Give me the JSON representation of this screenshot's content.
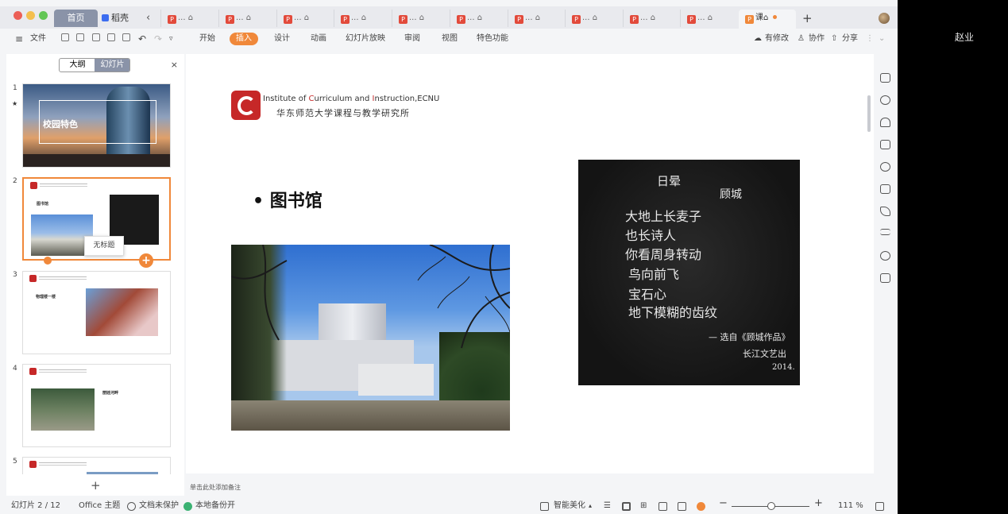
{
  "right_panel": {
    "username": "赵业"
  },
  "tabbar": {
    "home_label": "首页",
    "daoke_label": "稻壳",
    "nav_back": "‹",
    "doc_tab_label": "...",
    "active_tab_label": "课",
    "new_tab": "+"
  },
  "menubar": {
    "file_label": "文件",
    "menus": [
      "开始",
      "插入",
      "设计",
      "动画",
      "幻灯片放映",
      "审阅",
      "视图",
      "特色功能"
    ],
    "active_menu": "插入",
    "has_changes": "有修改",
    "collaborate": "协作",
    "share": "分享"
  },
  "leftpanel": {
    "outline_tab": "大纲",
    "slides_tab": "幻灯片",
    "close": "×",
    "slides": [
      {
        "num": "1",
        "title": "校园特色"
      },
      {
        "num": "2",
        "title": "图书馆"
      },
      {
        "num": "3",
        "title": "物理楼一楼"
      },
      {
        "num": "4",
        "title": "丽娃河畔"
      },
      {
        "num": "5",
        "title": ""
      }
    ],
    "tooltip": "无标题",
    "add_slide": "+"
  },
  "slide": {
    "institute_en_prefix": "Institute of ",
    "institute_en_c1": "C",
    "institute_en_mid": "urriculum and ",
    "institute_en_i": "I",
    "institute_en_suffix": "nstruction,ECNU",
    "institute_cn": "华东师范大学课程与教学研究所",
    "bullet": "• 图书馆",
    "poem": {
      "title": "日晕",
      "author": "顾城",
      "lines": [
        "大地上长麦子",
        "也长诗人",
        "你看周身转动",
        "鸟向前飞",
        "宝石心",
        "地下模糊的齿纹"
      ],
      "source_1": "— 选自《顾城作品》",
      "source_2": "长江文艺出",
      "source_3": "2014."
    }
  },
  "notes_hint": "单击此处添加备注",
  "statusbar": {
    "slide_counter": "幻灯片 2 / 12",
    "theme": "Office 主题",
    "protect": "文档未保护",
    "backup": "本地备份开",
    "beautify": "智能美化",
    "zoom": "111 %"
  },
  "colors": {
    "accent": "#f0883a",
    "brand_red": "#c62828",
    "tab_gray": "#8a93a8"
  }
}
